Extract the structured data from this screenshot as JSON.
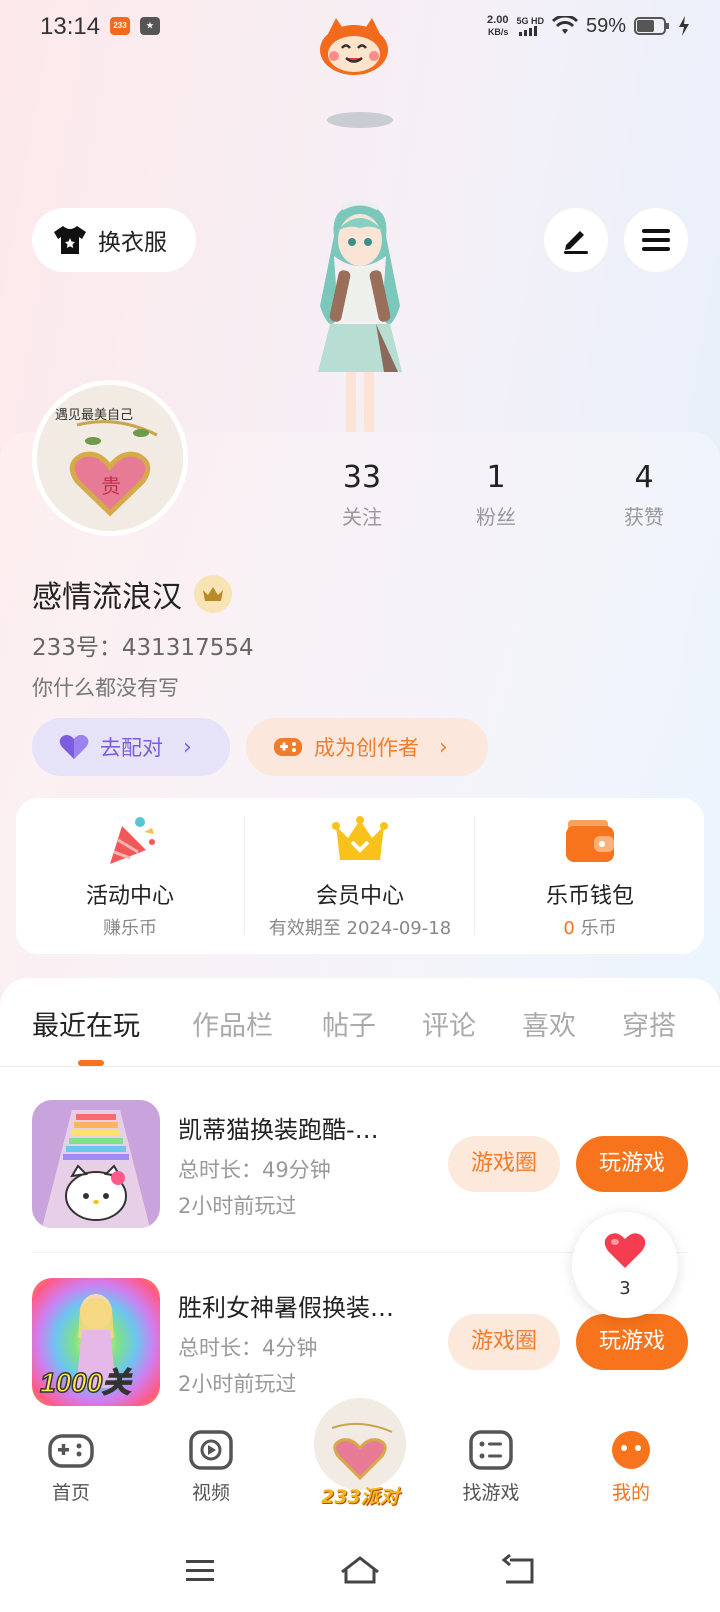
{
  "status_bar": {
    "time": "13:14",
    "badge1": "233",
    "net_speed_value": "2.00",
    "net_speed_unit": "KB/s",
    "signal_top": "5G HD",
    "battery": "59%"
  },
  "profile_actions": {
    "change_outfit": "换衣服"
  },
  "stats": [
    {
      "value": "33",
      "label": "关注"
    },
    {
      "value": "1",
      "label": "粉丝"
    },
    {
      "value": "4",
      "label": "获赞"
    }
  ],
  "user": {
    "name": "感情流浪汉",
    "uid": "233号：431317554",
    "bio": "你什么都没有写",
    "avatar_text": "遇见最美自己",
    "avatar_heart_char": "贵"
  },
  "tags": {
    "match": "去配对",
    "creator": "成为创作者"
  },
  "quick_links": [
    {
      "title": "活动中心",
      "sub": "赚乐币"
    },
    {
      "title": "会员中心",
      "sub": "有效期至 2024-09-18"
    },
    {
      "title": "乐币钱包",
      "sub_value": "0",
      "sub": "乐币"
    }
  ],
  "tabs": [
    "最近在玩",
    "作品栏",
    "帖子",
    "评论",
    "喜欢",
    "穿搭"
  ],
  "games": [
    {
      "name": "凯蒂猫换装跑酷-…",
      "duration": "总时长：49分钟",
      "last_played": "2小时前玩过",
      "circle_btn": "游戏圈",
      "play_btn": "玩游戏"
    },
    {
      "name": "胜利女神暑假换装…",
      "duration": "总时长：4分钟",
      "last_played": "2小时前玩过",
      "circle_btn": "游戏圈",
      "play_btn": "玩游戏",
      "thumb_text": "1000关"
    }
  ],
  "like_count": "3",
  "bottom_nav": [
    {
      "label": "首页"
    },
    {
      "label": "视频"
    },
    {
      "label": "233派对"
    },
    {
      "label": "找游戏"
    },
    {
      "label": "我的"
    }
  ],
  "colors": {
    "accent": "#f7731c",
    "purple": "#7c5de0"
  }
}
